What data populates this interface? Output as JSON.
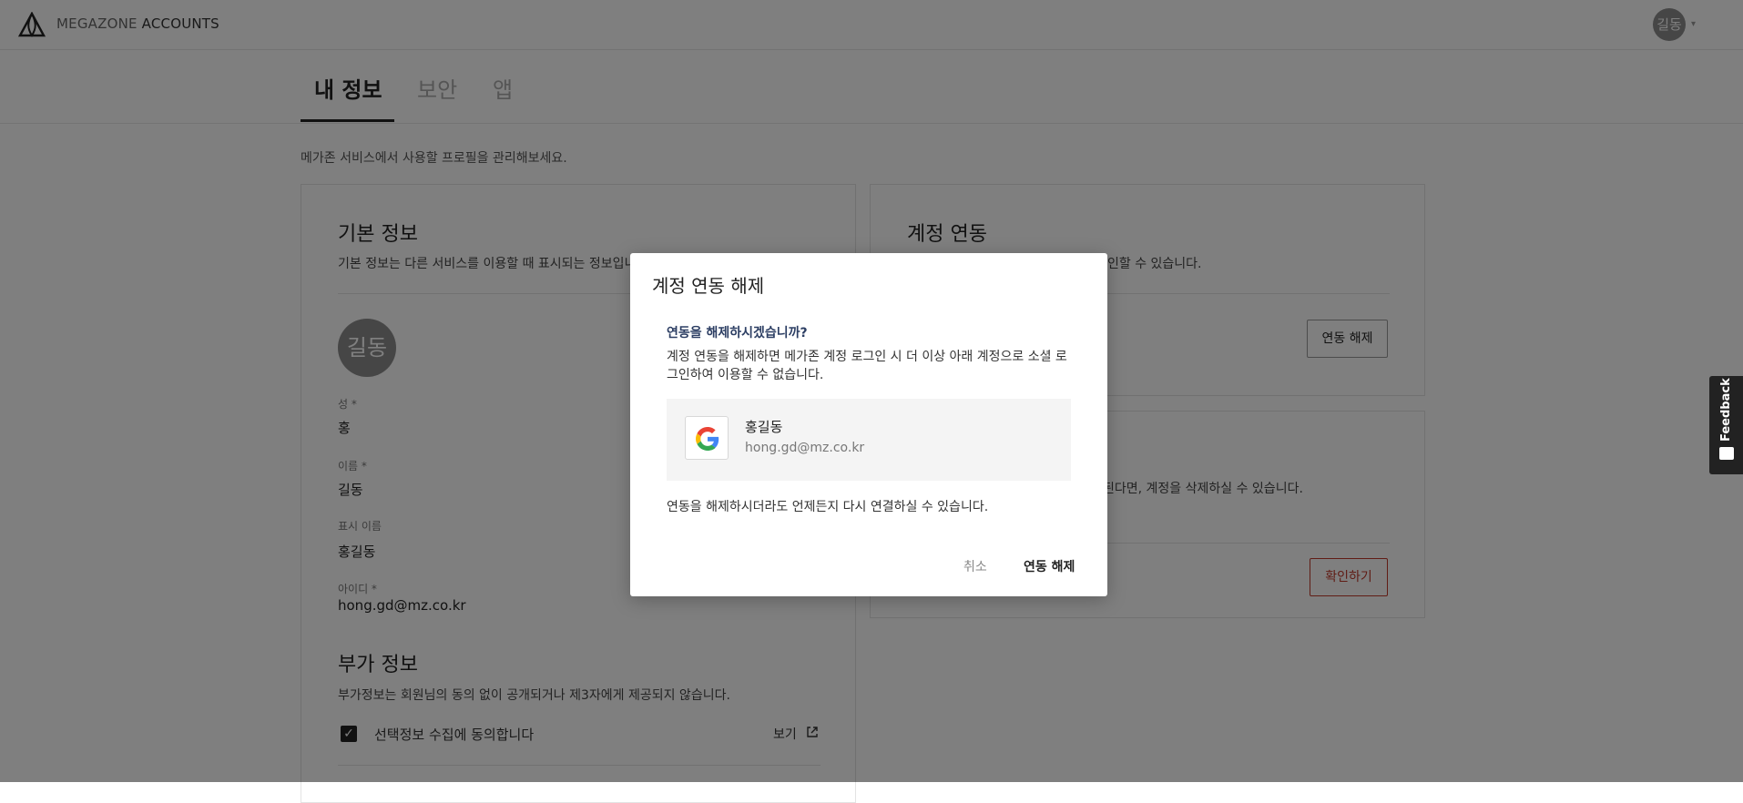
{
  "header": {
    "brand_prefix": "MEGAZONE",
    "brand_suffix": "ACCOUNTS",
    "avatar_initials": "길동"
  },
  "tabs": [
    {
      "label": "내 정보",
      "active": true
    },
    {
      "label": "보안",
      "active": false
    },
    {
      "label": "앱",
      "active": false
    }
  ],
  "page": {
    "description": "메가존 서비스에서 사용할 프로필을 관리해보세요."
  },
  "basic_info": {
    "title": "기본 정보",
    "subtitle": "기본 정보는 다른 서비스를 이용할 때 표시되는 정보입니다.",
    "avatar_initials": "길동",
    "fields": [
      {
        "label": "성 *",
        "value": "홍"
      },
      {
        "label": "이름 *",
        "value": "길동"
      },
      {
        "label": "표시 이름",
        "value": "홍길동"
      },
      {
        "label": "아이디 *",
        "value": "hong.gd@mz.co.kr"
      }
    ]
  },
  "extra_info": {
    "title": "부가 정보",
    "subtitle": "부가정보는 회원님의 동의 없이 공개되거나 제3자에게 제공되지 않습니다.",
    "consent_label": "선택정보 수집에 동의합니다",
    "consent_checked": true,
    "view_label": "보기"
  },
  "account_link": {
    "title": "계정 연동",
    "subtitle_visible": "인할 수 있습니다.",
    "unlink_button": "연동 해제"
  },
  "delete_card": {
    "line1_visible": "된다면, 계정을 삭제하실 수 있습니다.",
    "line2_visible": ".",
    "confirm_button": "확인하기"
  },
  "feedback": {
    "label": "Feedback"
  },
  "modal": {
    "title": "계정 연동 해제",
    "question": "연동을 해제하시겠습니까?",
    "body": "계정 연동을 해제하면 메가존 계정 로그인 시 더 이상 아래 계정으로 소셜 로그인하여 이용할 수 없습니다.",
    "account": {
      "provider_icon": "google-icon",
      "name": "홍길동",
      "email": "hong.gd@mz.co.kr"
    },
    "note": "연동을 해제하시더라도 언제든지 다시 연결하실 수 있습니다.",
    "cancel_label": "취소",
    "confirm_label": "연동 해제"
  },
  "colors": {
    "overlay": "#000000",
    "danger": "#c0392b",
    "question": "#2c3e63"
  }
}
